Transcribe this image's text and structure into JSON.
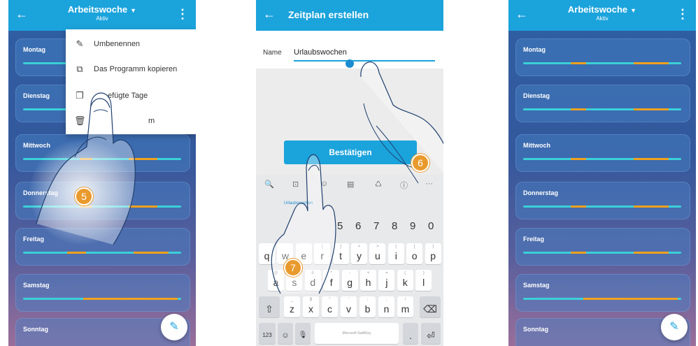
{
  "panel1": {
    "title": "Arbeitswoche",
    "subtitle": "Aktiv",
    "days": [
      "Montag",
      "Dienstag",
      "Mittwoch",
      "Donnerstag",
      "Freitag",
      "Samstag",
      "Sonntag"
    ],
    "menu": [
      {
        "label": "Umbenennen",
        "icon": "pencil-icon",
        "glyph": "✎"
      },
      {
        "label": "Das Programm kopieren",
        "icon": "copy-program-icon",
        "glyph": "⧉"
      },
      {
        "label": "efügte Tage",
        "icon": "copy-icon",
        "glyph": "❐"
      },
      {
        "label": "m",
        "icon": "trash-icon",
        "glyph": "🗑"
      }
    ],
    "step": "5"
  },
  "panel2": {
    "title": "Zeitplan erstellen",
    "name_label": "Name",
    "name_value": "Urlaubswochen",
    "confirm_label": "Bestätigen",
    "suggestion": "Urlaubswochen",
    "steps": [
      "6",
      "7"
    ],
    "toolbar_icons": [
      "search-icon",
      "sticker-icon",
      "emoji-icon",
      "clipboard-icon",
      "gif-icon",
      "info-icon",
      "more-icon"
    ],
    "toolbar_glyphs": [
      "🔍",
      "⊡",
      "☺",
      "▤",
      "♺",
      "ⓘ",
      "···"
    ],
    "number_row": [
      "5",
      "6",
      "7",
      "8",
      "9",
      "0"
    ],
    "row_q": [
      {
        "k": "q",
        "s": ""
      },
      {
        "k": "w",
        "s": ""
      },
      {
        "k": "e",
        "s": ""
      },
      {
        "k": "r",
        "s": "["
      },
      {
        "k": "t",
        "s": "]"
      },
      {
        "k": "y",
        "s": "<"
      },
      {
        "k": "u",
        "s": ">"
      },
      {
        "k": "i",
        "s": "("
      },
      {
        "k": "o",
        "s": "{"
      },
      {
        "k": "p",
        "s": ")"
      }
    ],
    "row_a": [
      {
        "k": "a",
        "s": "@"
      },
      {
        "k": "s",
        "s": "#"
      },
      {
        "k": "d",
        "s": "&"
      },
      {
        "k": "f",
        "s": "*"
      },
      {
        "k": "g",
        "s": "-"
      },
      {
        "k": "h",
        "s": "+"
      },
      {
        "k": "j",
        "s": "="
      },
      {
        "k": "k",
        "s": "("
      },
      {
        "k": "l",
        "s": ")"
      }
    ],
    "row_z": [
      {
        "k": "z",
        "s": "_"
      },
      {
        "k": "x",
        "s": "$"
      },
      {
        "k": "c",
        "s": "\""
      },
      {
        "k": "v",
        "s": "'"
      },
      {
        "k": "b",
        "s": ":"
      },
      {
        "k": "n",
        "s": ";"
      },
      {
        "k": "m",
        "s": "/"
      }
    ],
    "shift_glyph": "⇧",
    "backspace_glyph": "⌫",
    "num_key": "123",
    "emoji_key": "☺",
    "mic_key": "🎙",
    "space_label": "Microsoft SwiftKey",
    "period_key": ".",
    "enter_glyph": "⏎"
  },
  "panel3": {
    "title": "Arbeitswoche",
    "subtitle": "Aktiv",
    "days": [
      "Montag",
      "Dienstag",
      "Mittwoch",
      "Donnerstag",
      "Freitag",
      "Samstag",
      "Sonntag"
    ]
  },
  "icons": {
    "back": "←",
    "kebab": "⋮",
    "caret": "▼",
    "fab": "✎"
  },
  "colors": {
    "topbar": "#1ba3dc",
    "callout": "#e99a2c",
    "track_cyan": "#3ad1d8",
    "track_orange": "#f0a21c"
  }
}
